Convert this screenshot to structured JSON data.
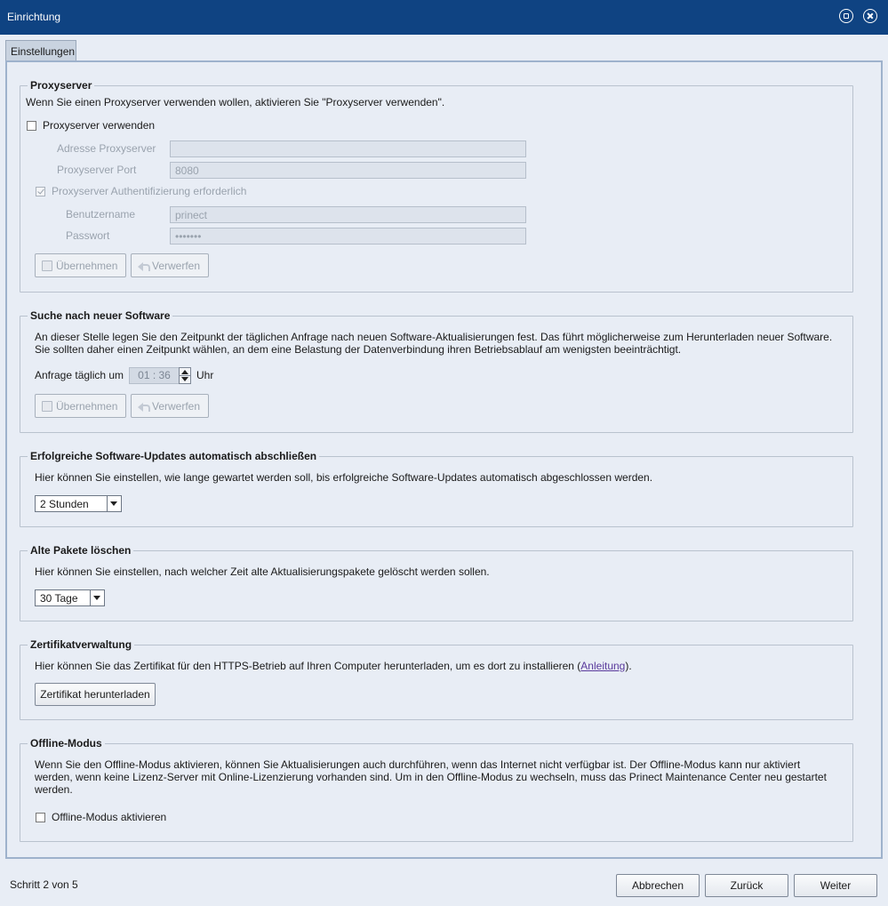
{
  "window": {
    "title": "Einrichtung"
  },
  "tabs": [
    {
      "label": "Einstellungen"
    }
  ],
  "proxy": {
    "legend": "Proxyserver",
    "description": "Wenn Sie einen Proxyserver verwenden wollen, aktivieren Sie \"Proxyserver verwenden\".",
    "use_proxy_label": "Proxyserver verwenden",
    "address_label": "Adresse Proxyserver",
    "address_value": "",
    "port_label": "Proxyserver Port",
    "port_value": "8080",
    "auth_label": "Proxyserver Authentifizierung erforderlich",
    "username_label": "Benutzername",
    "username_value": "prinect",
    "password_label": "Passwort",
    "password_value": "•••••••",
    "apply_label": "Übernehmen",
    "discard_label": "Verwerfen"
  },
  "software": {
    "legend": "Suche nach neuer Software",
    "description_line1": "An dieser Stelle legen Sie den Zeitpunkt der täglichen Anfrage nach neuen Software-Aktualisierungen fest. Das führt möglicherweise zum Herunterladen neuer Software.",
    "description_line2": "Sie sollten daher einen Zeitpunkt wählen, an dem eine Belastung der Datenverbindung ihren Betriebsablauf am wenigsten beeinträchtigt.",
    "daily_label": "Anfrage täglich um",
    "time_value": "01 : 36",
    "unit_label": "Uhr",
    "apply_label": "Übernehmen",
    "discard_label": "Verwerfen"
  },
  "updates": {
    "legend": "Erfolgreiche Software-Updates automatisch abschließen",
    "description": "Hier können Sie einstellen, wie lange gewartet werden soll, bis erfolgreiche Software-Updates automatisch abgeschlossen werden.",
    "selected": "2 Stunden"
  },
  "packages": {
    "legend": "Alte Pakete löschen",
    "description": "Hier können Sie einstellen, nach welcher Zeit alte Aktualisierungspakete gelöscht werden sollen.",
    "selected": "30 Tage"
  },
  "certificate": {
    "legend": "Zertifikatverwaltung",
    "description_before": "Hier können Sie das Zertifikat für den HTTPS-Betrieb auf Ihren Computer herunterladen, um es dort zu installieren (",
    "link_text": "Anleitung",
    "description_after": ").",
    "download_label": "Zertifikat herunterladen"
  },
  "offline": {
    "legend": "Offline-Modus",
    "description_line1": "Wenn Sie den Offline-Modus aktivieren, können Sie Aktualisierungen auch durchführen, wenn das Internet nicht verfügbar ist. Der Offline-Modus kann nur aktiviert",
    "description_line2": "werden, wenn keine Lizenz-Server mit Online-Lizenzierung vorhanden sind. Um in den Offline-Modus zu wechseln, muss das Prinect Maintenance Center neu gestartet",
    "description_line3": "werden.",
    "activate_label": "Offline-Modus aktivieren"
  },
  "footer": {
    "step_text": "Schritt 2 von 5",
    "cancel_label": "Abbrechen",
    "back_label": "Zurück",
    "next_label": "Weiter"
  }
}
